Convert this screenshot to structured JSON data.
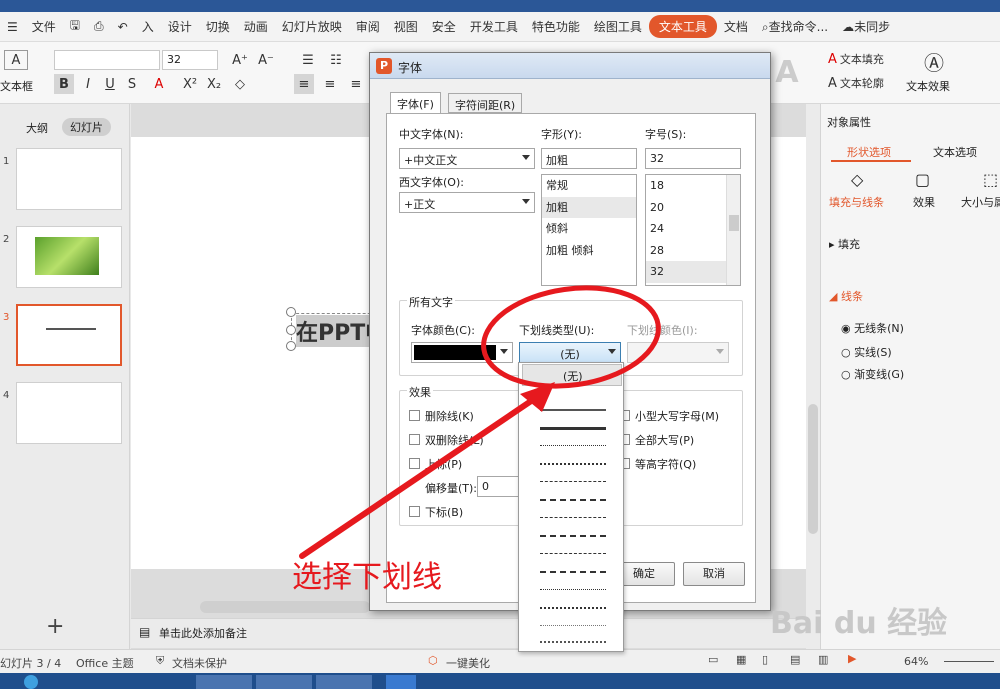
{
  "menubar": {
    "file": "文件",
    "items": [
      "设计",
      "切换",
      "动画",
      "幻灯片放映",
      "审阅",
      "视图",
      "安全",
      "开发工具",
      "特色功能",
      "绘图工具"
    ],
    "active": "文本工具",
    "more": "文档",
    "search": "查找命令...",
    "sync": "未同步",
    "in": "入"
  },
  "toolbar": {
    "font_size": "32",
    "textbox_label": "文本框",
    "text_fill": "文本填充",
    "text_outline": "文本轮廓",
    "text_effect": "文本效果"
  },
  "leftpanel": {
    "tab_outline": "大纲",
    "tab_slides": "幻灯片",
    "slides": [
      "1",
      "2",
      "3",
      "4"
    ],
    "add": "+"
  },
  "slide": {
    "text": "在PPT中"
  },
  "notes": {
    "placeholder": "单击此处添加备注"
  },
  "rightpanel": {
    "title": "对象属性",
    "tab_shape": "形状选项",
    "tab_text": "文本选项",
    "sub_fill_line": "填充与线条",
    "sub_effect": "效果",
    "sub_size": "大小与属",
    "fill": "填充",
    "line": "线条",
    "options": [
      "无线条(N)",
      "实线(S)",
      "渐变线(G)"
    ]
  },
  "statusbar": {
    "slide_count": "幻灯片 3 / 4",
    "theme": "Office 主题",
    "protect": "文档未保护",
    "beautify": "一键美化",
    "zoom": "64%"
  },
  "dialog": {
    "title": "字体",
    "tab_font": "字体(F)",
    "tab_spacing": "字符间距(R)",
    "cn_font_label": "中文字体(N):",
    "cn_font_value": "+中文正文",
    "west_font_label": "西文字体(O):",
    "west_font_value": "+正文",
    "style_label": "字形(Y):",
    "style_value": "加粗",
    "style_options": [
      "常规",
      "加粗",
      "倾斜",
      "加粗 倾斜"
    ],
    "size_label": "字号(S):",
    "size_value": "32",
    "size_options": [
      "18",
      "20",
      "24",
      "28",
      "32"
    ],
    "all_text": "所有文字",
    "font_color_label": "字体颜色(C):",
    "underline_type_label": "下划线类型(U):",
    "underline_type_value": "(无)",
    "underline_color_label": "下划线颜色(I):",
    "effects": "效果",
    "strikethrough": "删除线(K)",
    "double_strike": "双删除线(L)",
    "superscript": "上标(P)",
    "offset_label": "偏移量(T):",
    "offset_value": "0",
    "subscript": "下标(B)",
    "small_caps": "小型大写字母(M)",
    "all_caps": "全部大写(P)",
    "equal_height": "等高字符(Q)",
    "ok": "确定",
    "cancel": "取消"
  },
  "underline_dropdown": {
    "none": "(无)"
  },
  "annotation": "选择下划线",
  "watermark": "Bai du 经验",
  "colors": {
    "accent": "#e2572b",
    "annotation_red": "#e6191e"
  }
}
